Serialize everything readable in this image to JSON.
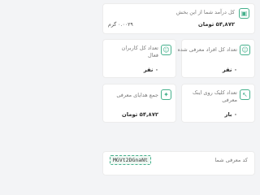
{
  "top_card": {
    "title": "کل درآمد شما از این بخش",
    "value": "۵۴,۸۷۲ تومان",
    "sub_value": "۰.۰۰۲۹ گرم"
  },
  "stats": [
    {
      "label_line1": "تعداد کل افراد معرفی شده",
      "label_line2": "",
      "value": "۰ نفر"
    },
    {
      "label_line1": "تعداد کل کاربران",
      "label_line2": "فعال",
      "value": "۰ نفر"
    },
    {
      "label_line1": "تعداد کلیک روی اینک",
      "label_line2": "معرفی",
      "value": "۰ بار"
    },
    {
      "label_line1": "جمع هدایای معرفی",
      "label_line2": "",
      "value": "۵۴,۸۷۲ تومان"
    }
  ],
  "bottom": {
    "label": "کد معرفی شما",
    "code": "MGVt2DGnaNt"
  }
}
